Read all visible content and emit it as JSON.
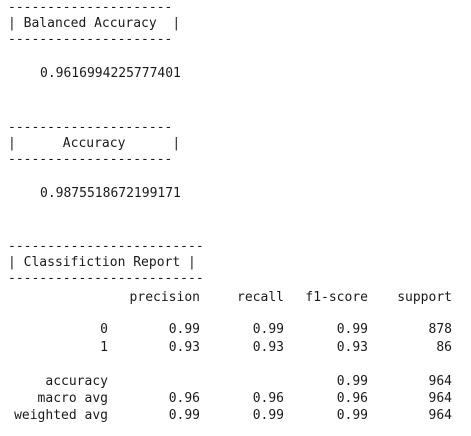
{
  "balanced": {
    "border_top": "---------------------",
    "header": "| Balanced Accuracy  |",
    "border_bottom": "---------------------",
    "value": "0.9616994225777401"
  },
  "accuracy": {
    "border_top": "---------------------",
    "header": "|      Accuracy      |",
    "border_bottom": "---------------------",
    "value": "0.9875518672199171"
  },
  "report": {
    "border_top": "-------------------------",
    "header": "| Classifiction Report |",
    "border_bottom": "-------------------------",
    "columns": [
      "precision",
      "recall",
      "f1-score",
      "support"
    ],
    "rows": [
      {
        "label": "0",
        "precision": "0.99",
        "recall": "0.99",
        "f1": "0.99",
        "support": "878"
      },
      {
        "label": "1",
        "precision": "0.93",
        "recall": "0.93",
        "f1": "0.93",
        "support": "86"
      },
      {
        "label": "accuracy",
        "precision": "",
        "recall": "",
        "f1": "0.99",
        "support": "964"
      },
      {
        "label": "macro avg",
        "precision": "0.96",
        "recall": "0.96",
        "f1": "0.96",
        "support": "964"
      },
      {
        "label": "weighted avg",
        "precision": "0.99",
        "recall": "0.99",
        "f1": "0.99",
        "support": "964"
      }
    ]
  }
}
